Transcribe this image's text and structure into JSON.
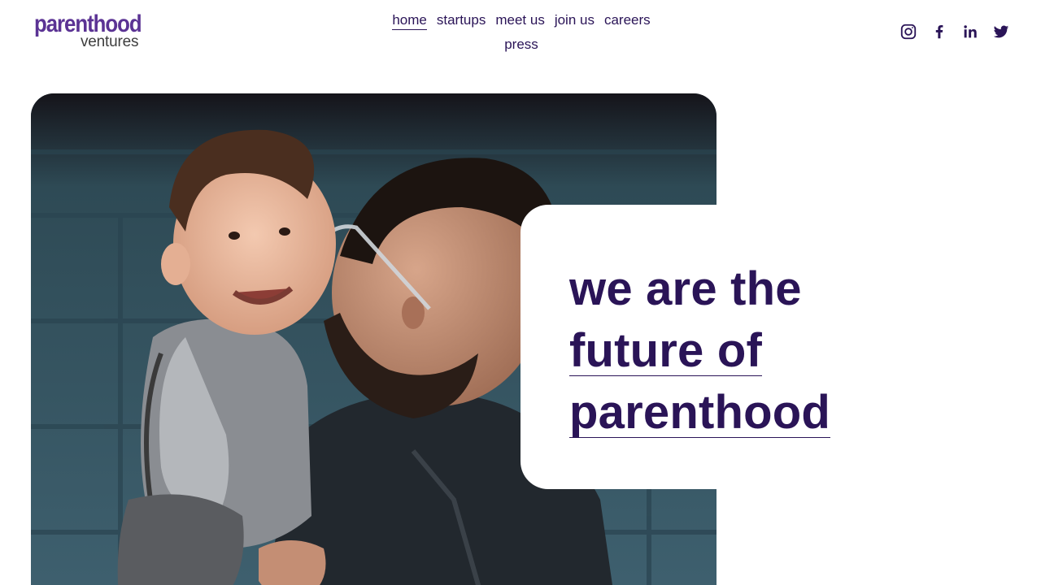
{
  "brand": {
    "logo_top": "parenthood",
    "logo_bottom": "ventures",
    "primary_color": "#2a1457",
    "logo_color": "#5b3394"
  },
  "nav": {
    "items": [
      {
        "label": "home",
        "active": true
      },
      {
        "label": "startups",
        "active": false
      },
      {
        "label": "meet us",
        "active": false
      },
      {
        "label": "join us",
        "active": false
      },
      {
        "label": "careers",
        "active": false
      },
      {
        "label": "press",
        "active": false
      }
    ]
  },
  "social": {
    "icons": [
      "instagram-icon",
      "facebook-icon",
      "linkedin-icon",
      "twitter-icon"
    ]
  },
  "hero": {
    "image_alt": "photo: father with glasses kissing smiling toddler",
    "tagline": {
      "line1": "we are the",
      "line2": "future of",
      "line3": "parenthood"
    }
  }
}
